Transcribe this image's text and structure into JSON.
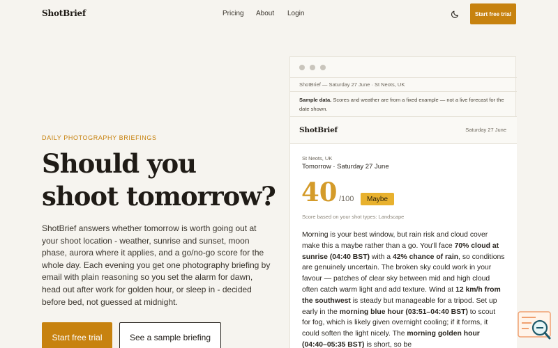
{
  "brand": {
    "name": "ShotBrief"
  },
  "nav": {
    "links": [
      "Pricing",
      "About",
      "Login"
    ],
    "theme_icon": "moon-icon",
    "cta": "Start free trial"
  },
  "hero": {
    "eyebrow": "DAILY PHOTOGRAPHY BRIEFINGS",
    "headline": "Should you shoot tomorrow?",
    "lede": "ShotBrief answers whether tomorrow is worth going out at your shoot location - weather, sunrise and sunset, moon phase, aurora where it applies, and a go/no-go score for the whole day. Each evening you get one photography briefing by email with plain reasoning so you set the alarm for dawn, head out after work for golden hour, or sleep in - decided before bed, not guessed at midnight.",
    "primary_cta": "Start free trial",
    "secondary_cta": "See a sample briefing"
  },
  "preview": {
    "subject": "ShotBrief — Saturday 27 June · St Neots, UK",
    "notice_strong": "Sample data.",
    "notice_text": "Scores and weather are from a fixed example — not a live forecast for the date shown.",
    "email_brand": "ShotBrief",
    "email_date": "Saturday 27 June",
    "location": "St Neots, UK",
    "day": "Tomorrow · Saturday 27 June",
    "score": "40",
    "score_max": "/100",
    "verdict": "Maybe",
    "score_note": "Score based on your shot types: Landscape",
    "brief": [
      {
        "t": "Morning is your best window, but rain risk and cloud cover make this a maybe rather than a go. You'll face ",
        "b": false
      },
      {
        "t": "70% cloud at sunrise (04:40 BST)",
        "b": true
      },
      {
        "t": " with a ",
        "b": false
      },
      {
        "t": "42% chance of rain",
        "b": true
      },
      {
        "t": ", so conditions are genuinely uncertain. The broken sky could work in your favour — patches of clear sky between mid and high cloud often catch warm light and add texture. Wind at ",
        "b": false
      },
      {
        "t": "12 km/h from the southwest",
        "b": true
      },
      {
        "t": " is steady but manageable for a tripod. Set up early in the ",
        "b": false
      },
      {
        "t": "morning blue hour (03:51–04:40 BST)",
        "b": true
      },
      {
        "t": " to scout for fog, which is likely given overnight cooling; if it forms, it could soften the light nicely. The ",
        "b": false
      },
      {
        "t": "morning golden hour (04:40–05:35 BST)",
        "b": true
      },
      {
        "t": " is short, so be",
        "b": false
      }
    ]
  },
  "colors": {
    "accent": "#c7820f",
    "score": "#d49b2a",
    "verdict": "#e8b12e",
    "background": "#f6f4ef"
  }
}
